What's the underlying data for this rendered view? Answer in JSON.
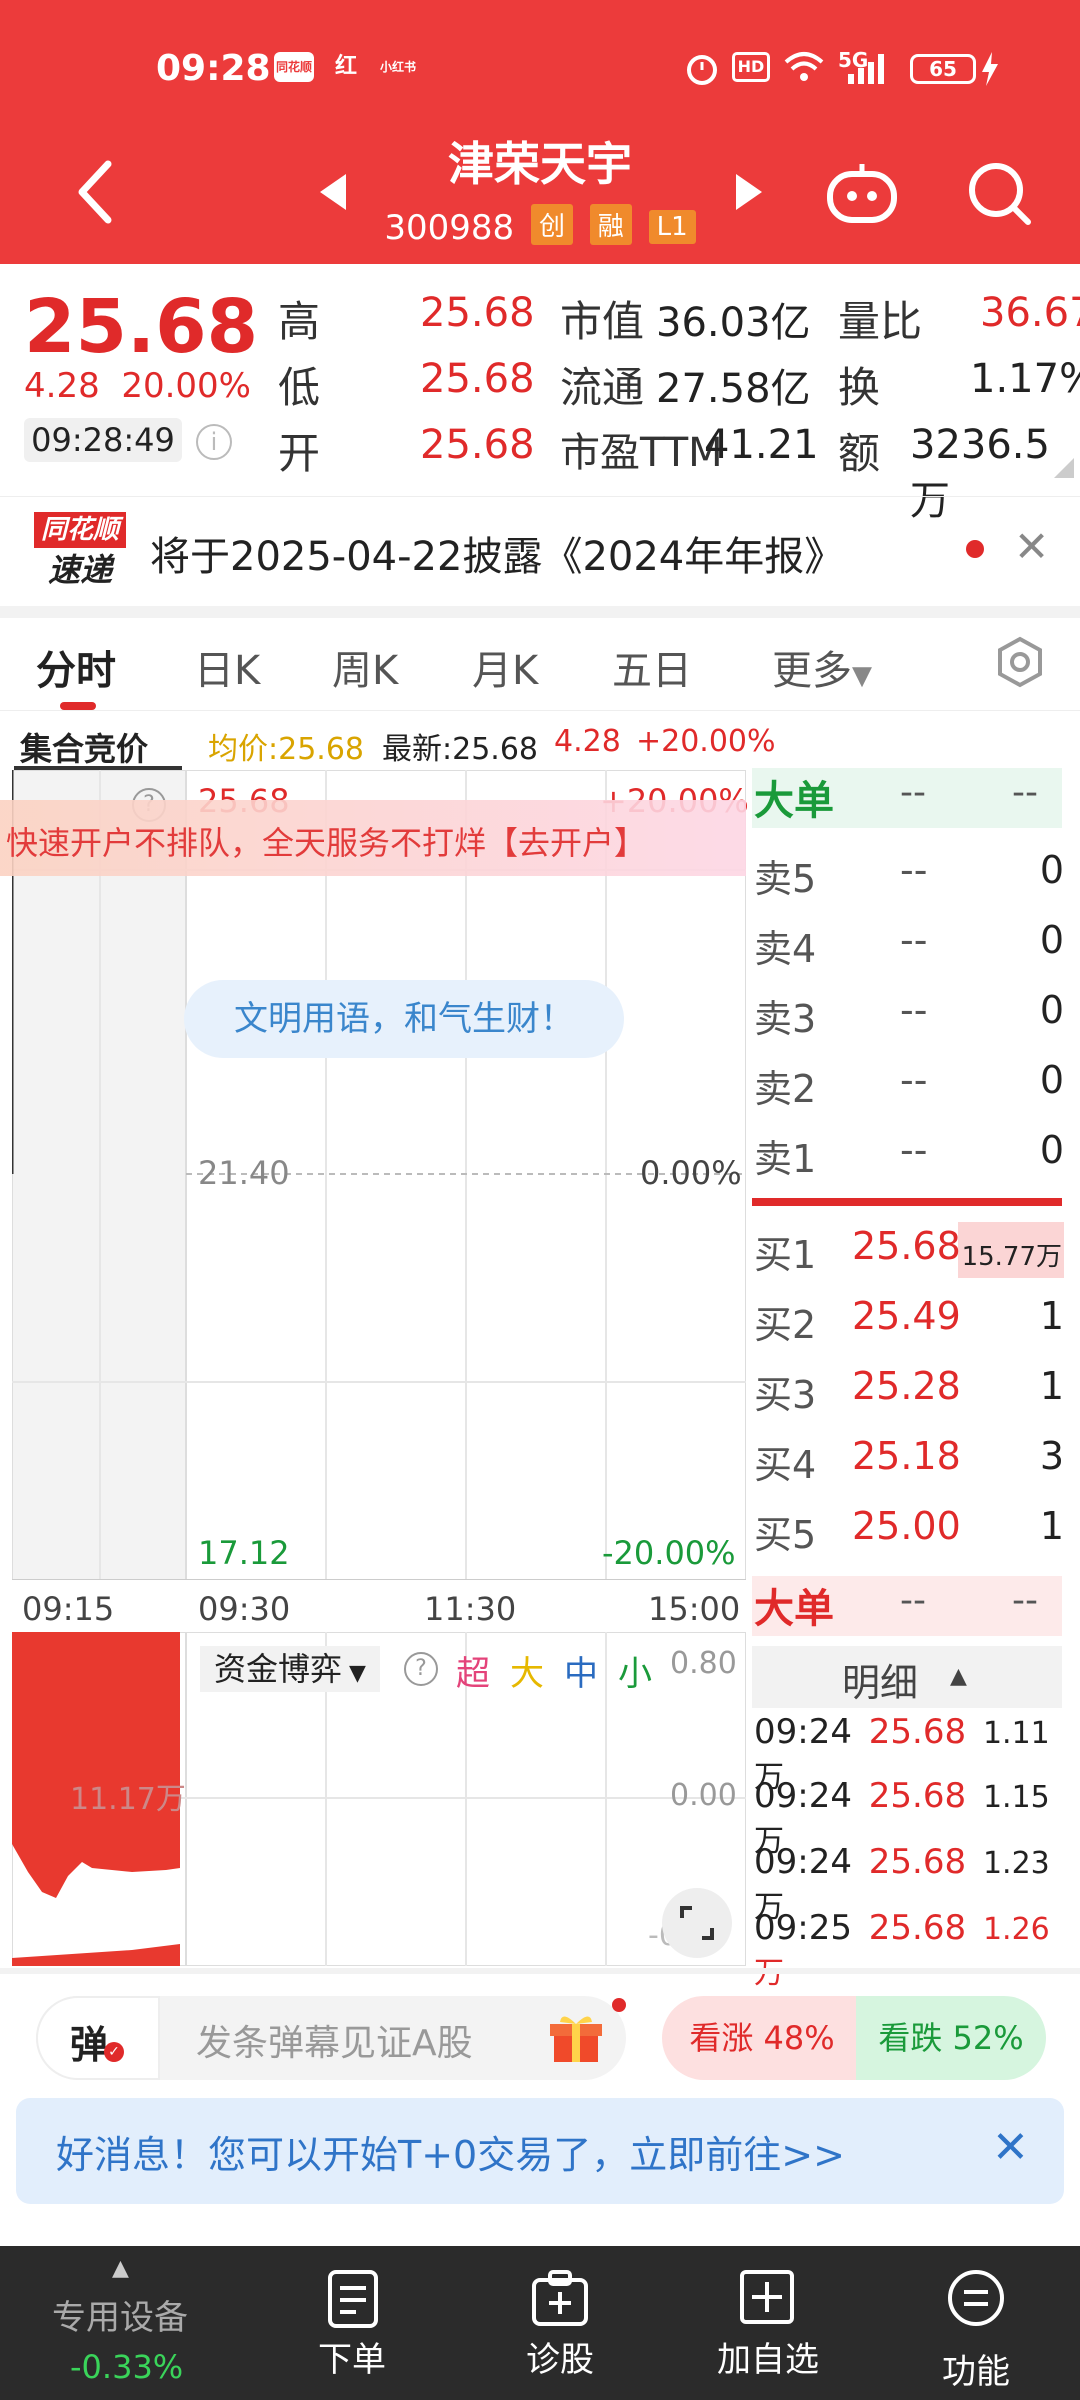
{
  "status_bar": {
    "time": "09:28",
    "app_icons": [
      "同花顺",
      "红",
      "小红书"
    ],
    "indicators": "HD",
    "network": "5G",
    "battery": "65"
  },
  "header": {
    "back_icon": "back-chevron-icon",
    "stock_name": "津荣天宇",
    "stock_code": "300988",
    "tags": [
      "创",
      "融",
      "L1"
    ]
  },
  "quote": {
    "price": "25.68",
    "change_amount": "4.28",
    "change_pct": "20.00%",
    "time": "09:28:49",
    "rows": [
      {
        "l1": "高",
        "v1": "25.68",
        "l2": "市值",
        "v2": "36.03亿",
        "l3": "量比",
        "v3": "36.67"
      },
      {
        "l1": "低",
        "v1": "25.68",
        "l2": "流通",
        "v2": "27.58亿",
        "l3": "换",
        "v3": "1.17%"
      },
      {
        "l1": "开",
        "v1": "25.68",
        "l2": "市盈TTM",
        "v2": "41.21",
        "l3": "额",
        "v3": "3236.5万"
      }
    ]
  },
  "news": {
    "logo_top": "同花顺",
    "logo_bottom": "速递",
    "text": "将于2025-04-22披露《2024年年报》"
  },
  "tabs": [
    "分时",
    "日K",
    "周K",
    "月K",
    "五日",
    "更多"
  ],
  "chart_header": {
    "auction": "集合竞价",
    "avg": "均价:25.68",
    "latest": "最新:25.68",
    "change": "4.28",
    "pct": "+20.00%"
  },
  "chart": {
    "top_price": "25.68",
    "top_pct": "+20.00%",
    "mid_price": "21.40",
    "mid_pct": "0.00%",
    "low_price": "17.12",
    "low_pct": "-20.00%",
    "banner": "快速开户不排队，全天服务不打烊【去开户】",
    "bubble": "文明用语，和气生财！",
    "time_ticks": [
      "09:15",
      "09:30",
      "11:30",
      "15:00"
    ]
  },
  "order_book": {
    "big_order_label": "大单",
    "placeholder": "--",
    "asks": [
      {
        "label": "卖5",
        "price": "--",
        "vol": "0"
      },
      {
        "label": "卖4",
        "price": "--",
        "vol": "0"
      },
      {
        "label": "卖3",
        "price": "--",
        "vol": "0"
      },
      {
        "label": "卖2",
        "price": "--",
        "vol": "0"
      },
      {
        "label": "卖1",
        "price": "--",
        "vol": "0"
      }
    ],
    "bids": [
      {
        "label": "买1",
        "price": "25.68",
        "vol": "15.77万"
      },
      {
        "label": "买2",
        "price": "25.49",
        "vol": "1"
      },
      {
        "label": "买3",
        "price": "25.28",
        "vol": "1"
      },
      {
        "label": "买4",
        "price": "25.18",
        "vol": "3"
      },
      {
        "label": "买5",
        "price": "25.00",
        "vol": "1"
      }
    ],
    "detail_label": "明细",
    "ticks": [
      {
        "time": "09:24",
        "price": "25.68",
        "vol": "1.11万"
      },
      {
        "time": "09:24",
        "price": "25.68",
        "vol": "1.15万"
      },
      {
        "time": "09:24",
        "price": "25.68",
        "vol": "1.23万"
      },
      {
        "time": "09:25",
        "price": "25.68",
        "vol": "1.26万"
      }
    ]
  },
  "capital_flow": {
    "title": "资金博弈",
    "legend": [
      "超",
      "大",
      "中",
      "小"
    ],
    "top": "0.80",
    "mid": "0.00",
    "bottom": "-0.80",
    "volume_label": "11.17万"
  },
  "bottom": {
    "danmu_icon_label": "弹",
    "danmu_placeholder": "发条弹幕见证A股",
    "vote_up": "看涨 48%",
    "vote_down": "看跌 52%",
    "promo": "好消息！您可以开始T+0交易了，立即前往>>"
  },
  "nav": {
    "device_label": "专用设备",
    "device_change": "-0.33%",
    "items": [
      "下单",
      "诊股",
      "加自选",
      "功能"
    ]
  }
}
